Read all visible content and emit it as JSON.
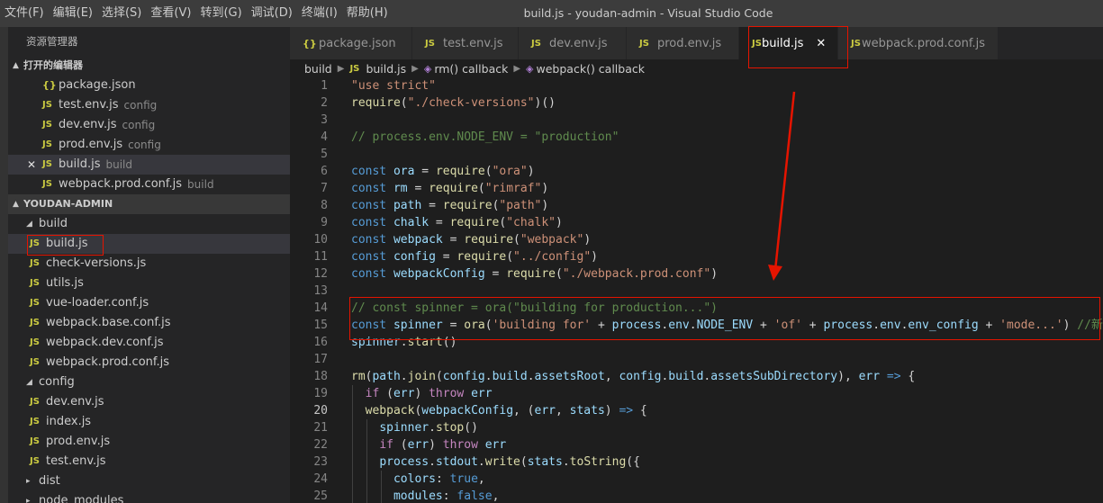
{
  "titlebar": {
    "menus": [
      "文件(F)",
      "编辑(E)",
      "选择(S)",
      "查看(V)",
      "转到(G)",
      "调试(D)",
      "终端(I)",
      "帮助(H)"
    ],
    "title": "build.js - youdan-admin - Visual Studio Code"
  },
  "sidebar": {
    "header": "资源管理器",
    "open_editors_title": "打开的编辑器",
    "open_editors": [
      {
        "icon": "{}",
        "name": "package.json",
        "desc": ""
      },
      {
        "icon": "JS",
        "name": "test.env.js",
        "desc": "config"
      },
      {
        "icon": "JS",
        "name": "dev.env.js",
        "desc": "config"
      },
      {
        "icon": "JS",
        "name": "prod.env.js",
        "desc": "config"
      },
      {
        "icon": "JS",
        "name": "build.js",
        "desc": "build"
      },
      {
        "icon": "JS",
        "name": "webpack.prod.conf.js",
        "desc": "build"
      }
    ],
    "project_title": "YOUDAN-ADMIN",
    "tree": {
      "build_folder": "build",
      "build_files": [
        "build.js",
        "check-versions.js",
        "utils.js",
        "vue-loader.conf.js",
        "webpack.base.conf.js",
        "webpack.dev.conf.js",
        "webpack.prod.conf.js"
      ],
      "config_folder": "config",
      "config_files": [
        "dev.env.js",
        "index.js",
        "prod.env.js",
        "test.env.js"
      ],
      "dist_folder": "dist",
      "node_modules_folder": "node_modules"
    }
  },
  "tabs": [
    {
      "icon": "{}",
      "label": "package.json"
    },
    {
      "icon": "JS",
      "label": "test.env.js"
    },
    {
      "icon": "JS",
      "label": "dev.env.js"
    },
    {
      "icon": "JS",
      "label": "prod.env.js"
    },
    {
      "icon": "JS",
      "label": "build.js",
      "close": "✕"
    },
    {
      "icon": "JS",
      "label": "webpack.prod.conf.js"
    }
  ],
  "breadcrumb": {
    "folder": "build",
    "file_icon": "JS",
    "file": "build.js",
    "symbol1": "rm() callback",
    "symbol2": "webpack() callback"
  },
  "editor": {
    "current_line": 20,
    "lines": [
      {
        "n": "1",
        "tokens": [
          [
            "str",
            "\"use strict\""
          ]
        ]
      },
      {
        "n": "2",
        "tokens": [
          [
            "fn",
            "require"
          ],
          [
            "plain",
            "("
          ],
          [
            "str",
            "\"./check-versions\""
          ],
          [
            "plain",
            ")()"
          ]
        ]
      },
      {
        "n": "3",
        "tokens": []
      },
      {
        "n": "4",
        "tokens": [
          [
            "com",
            "// process.env.NODE_ENV = \"production\""
          ]
        ]
      },
      {
        "n": "5",
        "tokens": []
      },
      {
        "n": "6",
        "tokens": [
          [
            "kw",
            "const "
          ],
          [
            "var",
            "ora"
          ],
          [
            "plain",
            " = "
          ],
          [
            "fn",
            "require"
          ],
          [
            "plain",
            "("
          ],
          [
            "str",
            "\"ora\""
          ],
          [
            "plain",
            ")"
          ]
        ]
      },
      {
        "n": "7",
        "tokens": [
          [
            "kw",
            "const "
          ],
          [
            "var",
            "rm"
          ],
          [
            "plain",
            " = "
          ],
          [
            "fn",
            "require"
          ],
          [
            "plain",
            "("
          ],
          [
            "str",
            "\"rimraf\""
          ],
          [
            "plain",
            ")"
          ]
        ]
      },
      {
        "n": "8",
        "tokens": [
          [
            "kw",
            "const "
          ],
          [
            "var",
            "path"
          ],
          [
            "plain",
            " = "
          ],
          [
            "fn",
            "require"
          ],
          [
            "plain",
            "("
          ],
          [
            "str",
            "\"path\""
          ],
          [
            "plain",
            ")"
          ]
        ]
      },
      {
        "n": "9",
        "tokens": [
          [
            "kw",
            "const "
          ],
          [
            "var",
            "chalk"
          ],
          [
            "plain",
            " = "
          ],
          [
            "fn",
            "require"
          ],
          [
            "plain",
            "("
          ],
          [
            "str",
            "\"chalk\""
          ],
          [
            "plain",
            ")"
          ]
        ]
      },
      {
        "n": "10",
        "tokens": [
          [
            "kw",
            "const "
          ],
          [
            "var",
            "webpack"
          ],
          [
            "plain",
            " = "
          ],
          [
            "fn",
            "require"
          ],
          [
            "plain",
            "("
          ],
          [
            "str",
            "\"webpack\""
          ],
          [
            "plain",
            ")"
          ]
        ]
      },
      {
        "n": "11",
        "tokens": [
          [
            "kw",
            "const "
          ],
          [
            "var",
            "config"
          ],
          [
            "plain",
            " = "
          ],
          [
            "fn",
            "require"
          ],
          [
            "plain",
            "("
          ],
          [
            "str",
            "\"../config\""
          ],
          [
            "plain",
            ")"
          ]
        ]
      },
      {
        "n": "12",
        "tokens": [
          [
            "kw",
            "const "
          ],
          [
            "var",
            "webpackConfig"
          ],
          [
            "plain",
            " = "
          ],
          [
            "fn",
            "require"
          ],
          [
            "plain",
            "("
          ],
          [
            "str",
            "\"./webpack.prod.conf\""
          ],
          [
            "plain",
            ")"
          ]
        ]
      },
      {
        "n": "13",
        "tokens": []
      },
      {
        "n": "14",
        "tokens": [
          [
            "com",
            "// const spinner = ora(\"building for production...\")"
          ]
        ]
      },
      {
        "n": "15",
        "tokens": [
          [
            "kw",
            "const "
          ],
          [
            "var",
            "spinner"
          ],
          [
            "plain",
            " = "
          ],
          [
            "fn",
            "ora"
          ],
          [
            "plain",
            "("
          ],
          [
            "str",
            "'building for'"
          ],
          [
            "plain",
            " + "
          ],
          [
            "var",
            "process"
          ],
          [
            "plain",
            "."
          ],
          [
            "var",
            "env"
          ],
          [
            "plain",
            "."
          ],
          [
            "var",
            "NODE_ENV"
          ],
          [
            "plain",
            " + "
          ],
          [
            "str",
            "'of'"
          ],
          [
            "plain",
            " + "
          ],
          [
            "var",
            "process"
          ],
          [
            "plain",
            "."
          ],
          [
            "var",
            "env"
          ],
          [
            "plain",
            "."
          ],
          [
            "var",
            "env_config"
          ],
          [
            "plain",
            " + "
          ],
          [
            "str",
            "'mode...'"
          ],
          [
            "plain",
            ") "
          ],
          [
            "com",
            "//新增"
          ]
        ]
      },
      {
        "n": "16",
        "tokens": [
          [
            "var",
            "spinner"
          ],
          [
            "plain",
            "."
          ],
          [
            "fn",
            "start"
          ],
          [
            "plain",
            "()"
          ]
        ]
      },
      {
        "n": "17",
        "tokens": []
      },
      {
        "n": "18",
        "tokens": [
          [
            "fn",
            "rm"
          ],
          [
            "plain",
            "("
          ],
          [
            "var",
            "path"
          ],
          [
            "plain",
            "."
          ],
          [
            "fn",
            "join"
          ],
          [
            "plain",
            "("
          ],
          [
            "var",
            "config"
          ],
          [
            "plain",
            "."
          ],
          [
            "var",
            "build"
          ],
          [
            "plain",
            "."
          ],
          [
            "var",
            "assetsRoot"
          ],
          [
            "plain",
            ", "
          ],
          [
            "var",
            "config"
          ],
          [
            "plain",
            "."
          ],
          [
            "var",
            "build"
          ],
          [
            "plain",
            "."
          ],
          [
            "var",
            "assetsSubDirectory"
          ],
          [
            "plain",
            "), "
          ],
          [
            "var",
            "err"
          ],
          [
            "plain",
            " "
          ],
          [
            "kw",
            "=>"
          ],
          [
            "plain",
            " {"
          ]
        ]
      },
      {
        "n": "19",
        "tokens": [
          [
            "plain",
            "  "
          ],
          [
            "ctl",
            "if"
          ],
          [
            "plain",
            " ("
          ],
          [
            "var",
            "err"
          ],
          [
            "plain",
            ") "
          ],
          [
            "ctl",
            "throw"
          ],
          [
            "plain",
            " "
          ],
          [
            "var",
            "err"
          ]
        ]
      },
      {
        "n": "20",
        "tokens": [
          [
            "plain",
            "  "
          ],
          [
            "fn",
            "webpack"
          ],
          [
            "plain",
            "("
          ],
          [
            "var",
            "webpackConfig"
          ],
          [
            "plain",
            ", ("
          ],
          [
            "var",
            "err"
          ],
          [
            "plain",
            ", "
          ],
          [
            "var",
            "stats"
          ],
          [
            "plain",
            ") "
          ],
          [
            "kw",
            "=>"
          ],
          [
            "plain",
            " {"
          ]
        ]
      },
      {
        "n": "21",
        "tokens": [
          [
            "plain",
            "    "
          ],
          [
            "var",
            "spinner"
          ],
          [
            "plain",
            "."
          ],
          [
            "fn",
            "stop"
          ],
          [
            "plain",
            "()"
          ]
        ]
      },
      {
        "n": "22",
        "tokens": [
          [
            "plain",
            "    "
          ],
          [
            "ctl",
            "if"
          ],
          [
            "plain",
            " ("
          ],
          [
            "var",
            "err"
          ],
          [
            "plain",
            ") "
          ],
          [
            "ctl",
            "throw"
          ],
          [
            "plain",
            " "
          ],
          [
            "var",
            "err"
          ]
        ]
      },
      {
        "n": "23",
        "tokens": [
          [
            "plain",
            "    "
          ],
          [
            "var",
            "process"
          ],
          [
            "plain",
            "."
          ],
          [
            "var",
            "stdout"
          ],
          [
            "plain",
            "."
          ],
          [
            "fn",
            "write"
          ],
          [
            "plain",
            "("
          ],
          [
            "var",
            "stats"
          ],
          [
            "plain",
            "."
          ],
          [
            "fn",
            "toString"
          ],
          [
            "plain",
            "({"
          ]
        ]
      },
      {
        "n": "24",
        "tokens": [
          [
            "plain",
            "      "
          ],
          [
            "var",
            "colors"
          ],
          [
            "plain",
            ": "
          ],
          [
            "kw",
            "true"
          ],
          [
            "plain",
            ","
          ]
        ]
      },
      {
        "n": "25",
        "tokens": [
          [
            "plain",
            "      "
          ],
          [
            "var",
            "modules"
          ],
          [
            "plain",
            ": "
          ],
          [
            "kw",
            "false"
          ],
          [
            "plain",
            ","
          ]
        ]
      }
    ]
  },
  "colors": {
    "annotation_red": "#e51400",
    "accent_yellow": "#cbcb41"
  }
}
